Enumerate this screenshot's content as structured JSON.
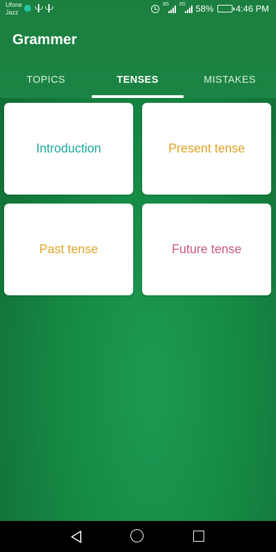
{
  "status_bar": {
    "carrier_line1": "Ufone",
    "carrier_line2": "Jazz",
    "net1": "3G",
    "net2": "2G",
    "battery": "58%",
    "battery_level": 0.58,
    "time": "4:46 PM"
  },
  "app": {
    "title": "Grammer"
  },
  "tabs": [
    {
      "label": "TOPICS",
      "active": false
    },
    {
      "label": "TENSES",
      "active": true
    },
    {
      "label": "MISTAKES",
      "active": false
    }
  ],
  "cards": [
    {
      "label": "Introduction",
      "color": "#1ca69c"
    },
    {
      "label": "Present tense",
      "color": "#e0a32a"
    },
    {
      "label": "Past tense",
      "color": "#dfa52a"
    },
    {
      "label": "Future tense",
      "color": "#c95a7a"
    }
  ],
  "colors": {
    "primary": "#1b8242",
    "background": "#17813f",
    "card": "#ffffff",
    "navbar": "#000000"
  },
  "icons": {
    "status": [
      "notification-dot-icon",
      "usb-icon",
      "usb-icon",
      "alarm-icon",
      "signal-icon",
      "signal-icon",
      "battery-icon"
    ],
    "nav": [
      "back-icon",
      "home-icon",
      "recent-apps-icon"
    ]
  }
}
